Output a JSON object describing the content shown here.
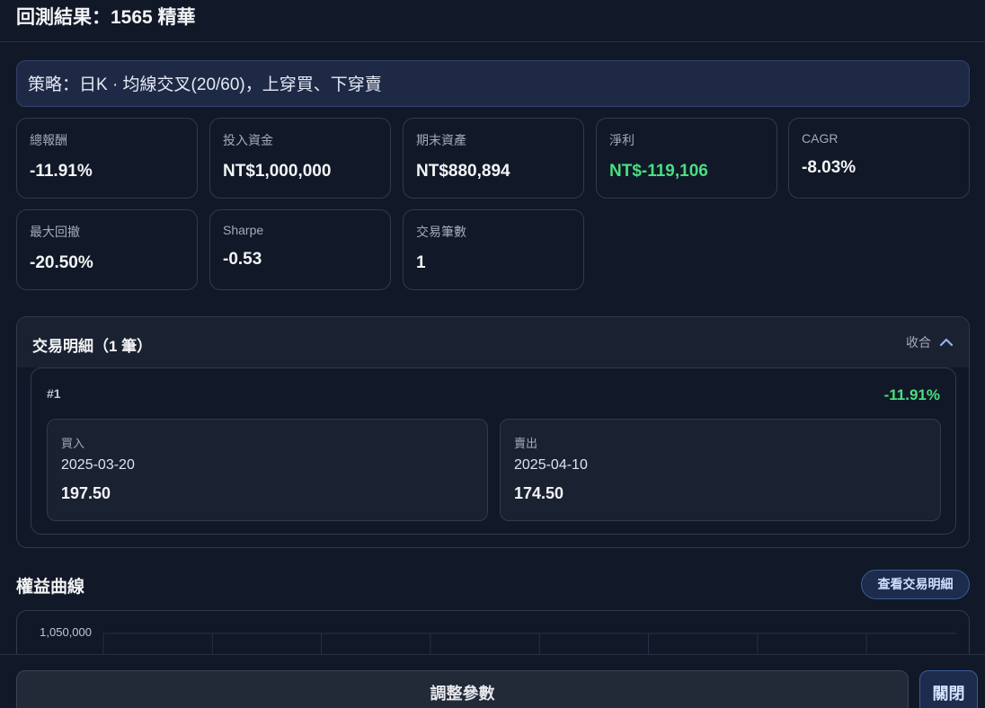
{
  "header": {
    "title": "回測結果：1565 精華"
  },
  "strategy": {
    "text": "策略：日K · 均線交叉(20/60)，上穿買、下穿賣"
  },
  "stats": [
    {
      "label": "總報酬",
      "value": "-11.91%"
    },
    {
      "label": "投入資金",
      "value": "NT$1,000,000"
    },
    {
      "label": "期末資產",
      "value": "NT$880,894"
    },
    {
      "label": "淨利",
      "value": "NT$-119,106",
      "color": "#4ade80"
    },
    {
      "label": "CAGR",
      "value": "-8.03%"
    },
    {
      "label": "最大回撤",
      "value": "-20.50%"
    },
    {
      "label": "Sharpe",
      "value": "-0.53"
    },
    {
      "label": "交易筆數",
      "value": "1"
    }
  ],
  "trades": {
    "title": "交易明細（1 筆）",
    "collapse_label": "收合",
    "items": [
      {
        "index": "#1",
        "return": "-11.91%",
        "buy": {
          "label": "買入",
          "date": "2025-03-20",
          "price": "197.50"
        },
        "sell": {
          "label": "賣出",
          "date": "2025-04-10",
          "price": "174.50"
        }
      }
    ]
  },
  "equity": {
    "title": "權益曲線",
    "view_trades_label": "查看交易明細",
    "top_tick_label": "1,050,000"
  },
  "footer": {
    "adjust_label": "調整參數",
    "close_label": "關閉"
  },
  "colors": {
    "background": "#111827",
    "positive_green": "#4ade80",
    "accent_blue": "#3b5b9a"
  }
}
